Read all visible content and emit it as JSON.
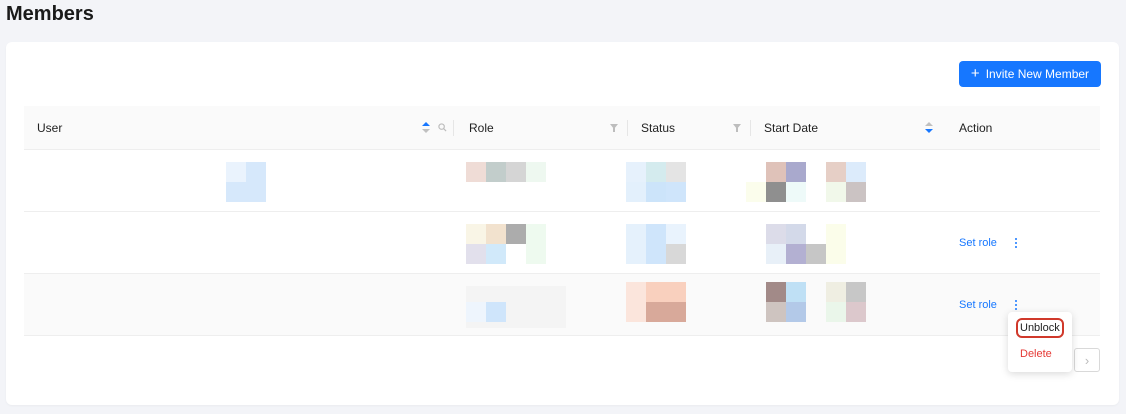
{
  "page": {
    "title": "Members"
  },
  "toolbar": {
    "invite_label": "Invite New Member",
    "invite_icon": "plus-icon"
  },
  "table": {
    "columns": [
      "User",
      "Role",
      "Status",
      "Start Date",
      "Action"
    ],
    "rows": [
      {
        "action": ""
      },
      {
        "action": "Set role"
      },
      {
        "action": "Set role"
      }
    ]
  },
  "menu": {
    "items": [
      "Unblock",
      "Delete"
    ]
  },
  "colors": {
    "accent": "#1677ff",
    "danger": "#e53935",
    "highlight": "#d0392b"
  }
}
